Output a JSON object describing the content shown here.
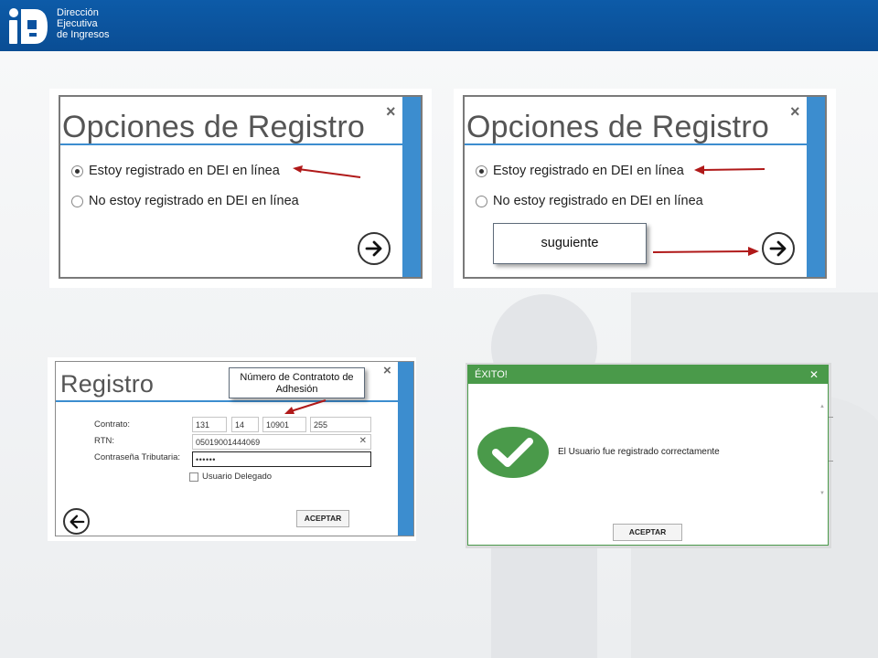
{
  "header": {
    "logo_lines": [
      "Dirección",
      "Ejecutiva",
      "de Ingresos"
    ],
    "brand_color": "#0b52a0"
  },
  "panel1": {
    "title": "Opciones de Registro",
    "close_icon": "close-icon",
    "options": [
      {
        "label": "Estoy registrado en DEI en línea",
        "selected": true
      },
      {
        "label": "No estoy registrado en DEI en línea",
        "selected": false
      }
    ],
    "next_icon": "arrow-right-icon"
  },
  "panel2": {
    "title": "Opciones de Registro",
    "close_icon": "close-icon",
    "options": [
      {
        "label": "Estoy registrado en DEI en línea",
        "selected": true
      },
      {
        "label": "No estoy registrado en DEI en línea",
        "selected": false
      }
    ],
    "callout": "suguiente",
    "next_icon": "arrow-right-icon"
  },
  "panel3": {
    "title": "Registro",
    "close_icon": "close-icon",
    "callout_lines": [
      "Número de Contratoto de",
      "Adhesión"
    ],
    "contrato_label": "Contrato:",
    "contrato_values": [
      "131",
      "14",
      "10901",
      "255"
    ],
    "rtn_label": "RTN:",
    "rtn_value": "05019001444069",
    "clear_icon": "clear-icon",
    "password_label": "Contraseña Tributaria:",
    "password_value": "••••••",
    "delegate_label": "Usuario Delegado",
    "accept_label": "ACEPTAR",
    "back_icon": "arrow-left-icon"
  },
  "panel4": {
    "title": "ÉXITO!",
    "close_icon": "close-icon",
    "message": "El Usuario fue registrado correctamente",
    "accept_label": "ACEPTAR",
    "success_color": "#4a9a4a"
  }
}
